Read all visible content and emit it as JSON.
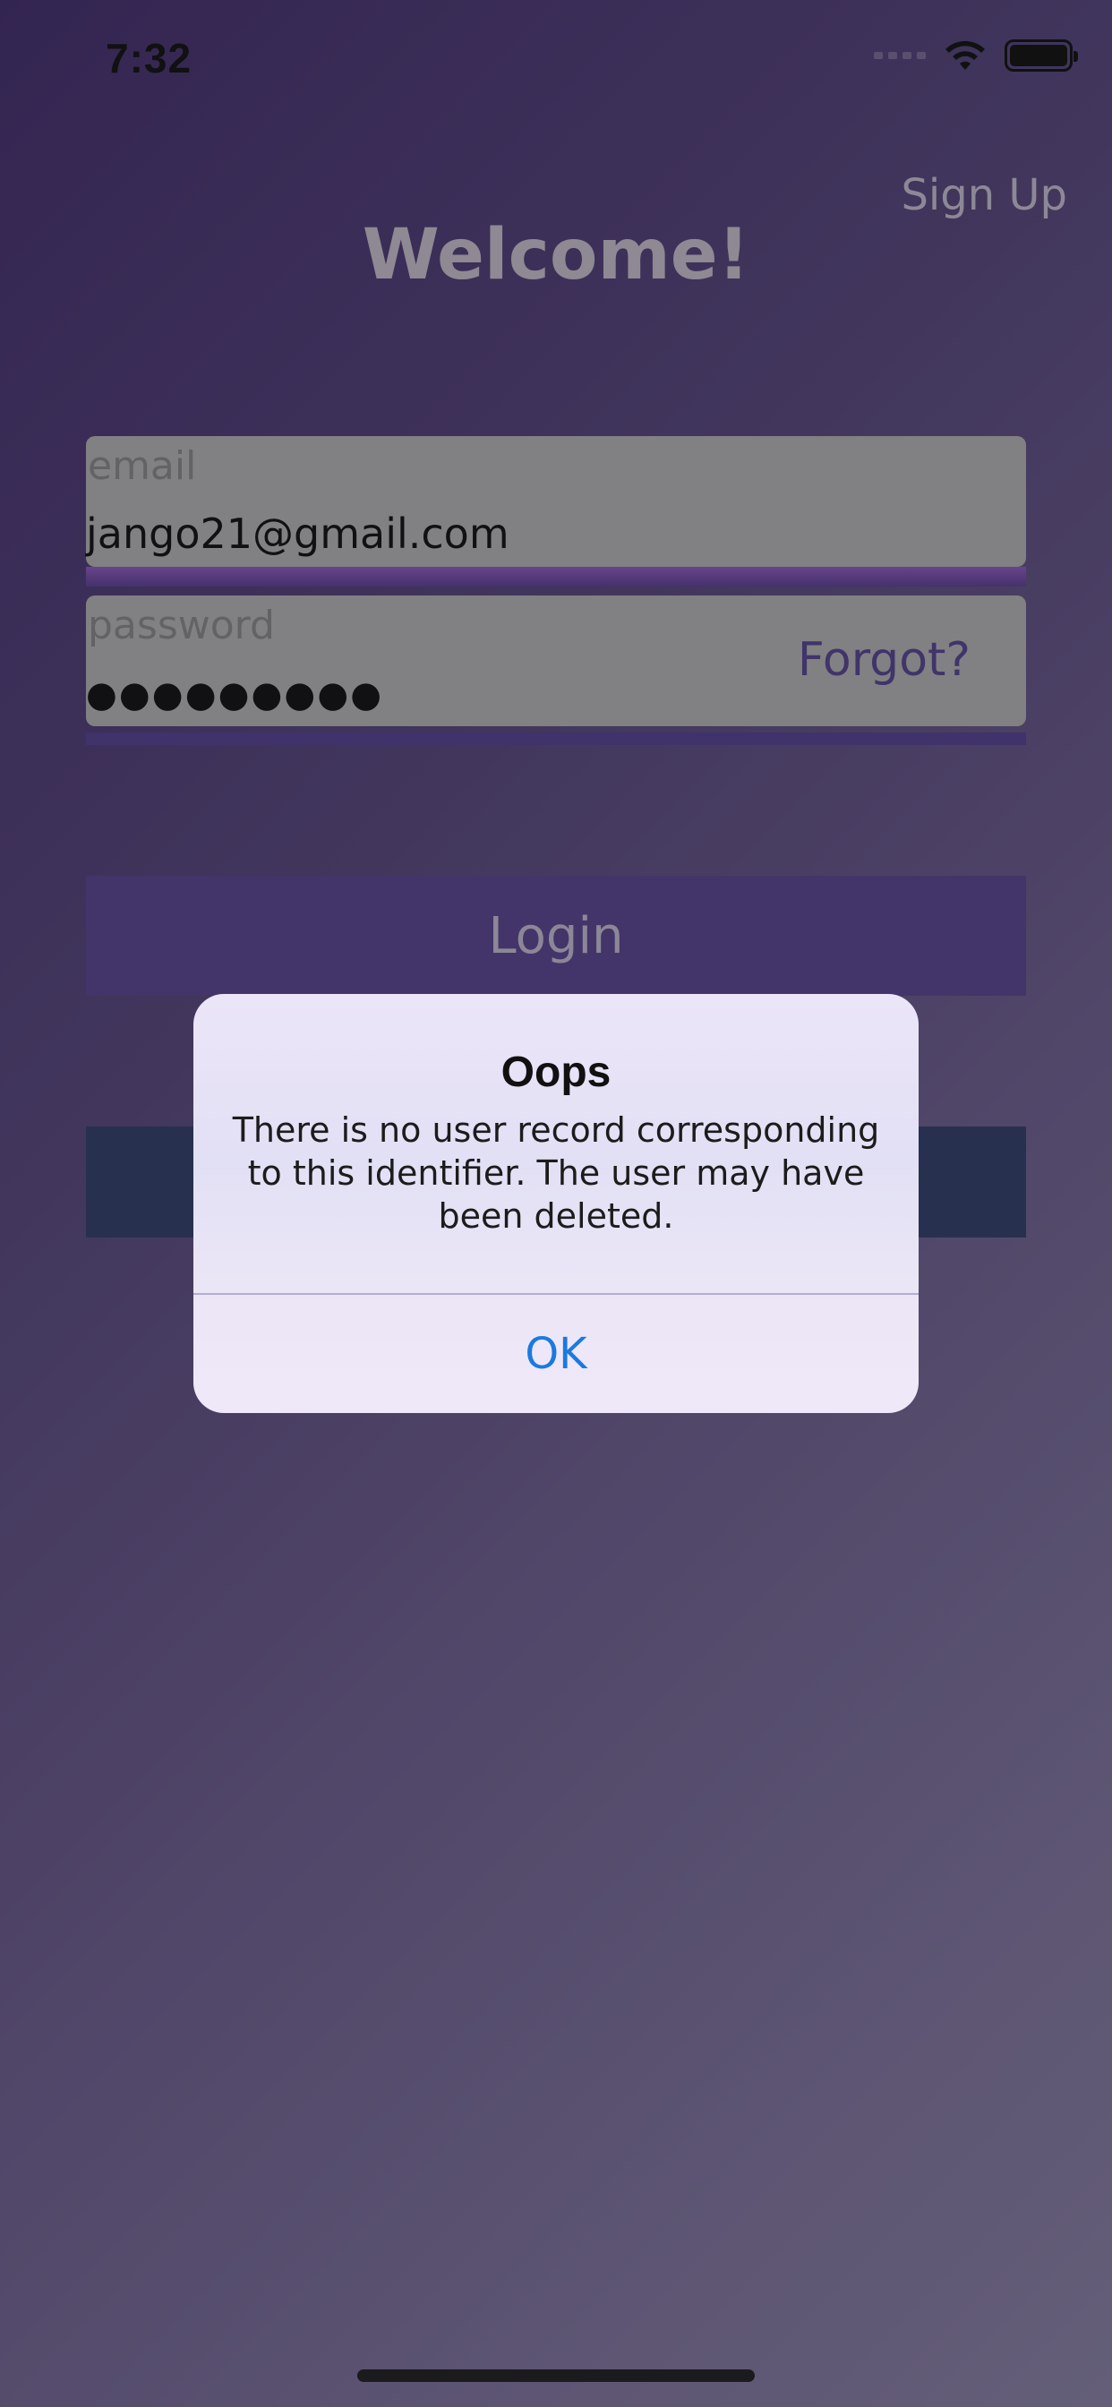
{
  "status_bar": {
    "time": "7:32",
    "icons": [
      "signal-icon",
      "wifi-icon",
      "battery-icon"
    ]
  },
  "header": {
    "signup_label": "Sign Up",
    "title": "Welcome!"
  },
  "form": {
    "email": {
      "label": "email",
      "value": "jango21@gmail.com"
    },
    "password": {
      "label": "password",
      "value": "●●●●●●●●●",
      "forgot_label": "Forgot?"
    },
    "login_label": "Login"
  },
  "alert": {
    "title": "Oops",
    "message": "There is no user record corresponding to this identifier. The user may have been deleted.",
    "ok_label": "OK"
  },
  "colors": {
    "accent_purple": "#4e3d79",
    "alert_button_blue": "#1a7ae0",
    "field_gray": "#999999"
  }
}
